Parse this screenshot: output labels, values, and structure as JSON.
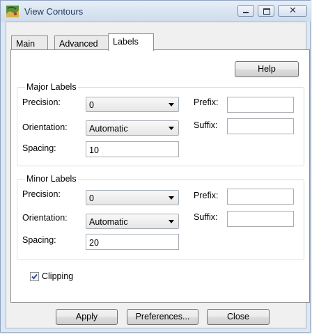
{
  "window": {
    "title": "View Contours"
  },
  "tabs": [
    {
      "label": "Main"
    },
    {
      "label": "Advanced"
    },
    {
      "label": "Labels"
    }
  ],
  "help_label": "Help",
  "major": {
    "title": "Major Labels",
    "precision_label": "Precision:",
    "precision_value": "0",
    "orientation_label": "Orientation:",
    "orientation_value": "Automatic",
    "spacing_label": "Spacing:",
    "spacing_value": "10",
    "prefix_label": "Prefix:",
    "prefix_value": "",
    "suffix_label": "Suffix:",
    "suffix_value": ""
  },
  "minor": {
    "title": "Minor Labels",
    "precision_label": "Precision:",
    "precision_value": "0",
    "orientation_label": "Orientation:",
    "orientation_value": "Automatic",
    "spacing_label": "Spacing:",
    "spacing_value": "20",
    "prefix_label": "Prefix:",
    "prefix_value": "",
    "suffix_label": "Suffix:",
    "suffix_value": ""
  },
  "clipping": {
    "label": "Clipping",
    "checked": true
  },
  "footer": {
    "apply": "Apply",
    "preferences": "Preferences...",
    "close": "Close"
  }
}
